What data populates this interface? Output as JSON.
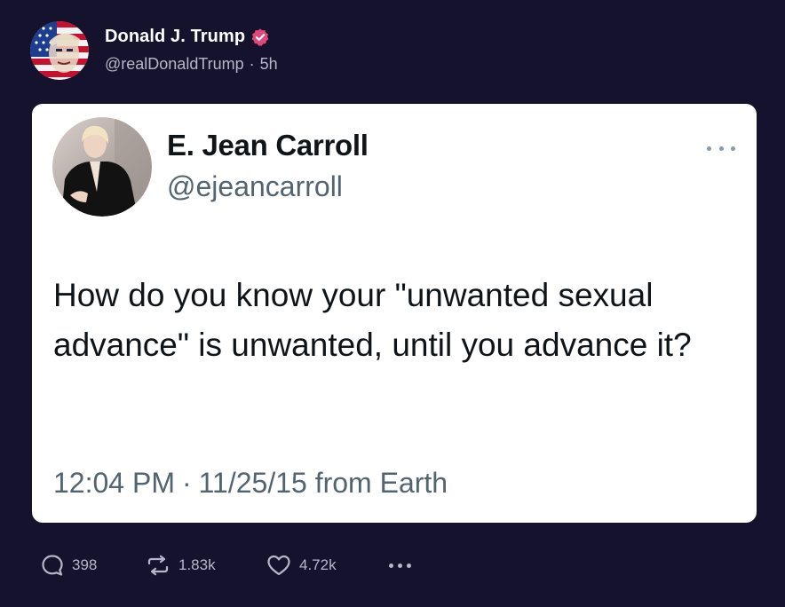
{
  "post": {
    "author_name": "Donald J. Trump",
    "author_handle": "@realDonaldTrump",
    "separator": "·",
    "timestamp": "5h"
  },
  "quoted_tweet": {
    "author_name": "E. Jean Carroll",
    "author_handle": "@ejeancarroll",
    "text": "How do you know your \"unwanted sexual advance\" is unwanted, until you advance it?",
    "time": "12:04 PM",
    "separator": "·",
    "date_source": "11/25/15 from Earth"
  },
  "actions": {
    "replies": "398",
    "reposts": "1.83k",
    "likes": "4.72k"
  },
  "icons": {
    "verified": "verified-badge-icon",
    "reply": "comment-bubble-icon",
    "repost": "repost-arrows-icon",
    "like": "heart-icon",
    "more": "more-dots-icon"
  },
  "colors": {
    "background": "#15122d",
    "verified_badge": "#e0487a",
    "card_background": "#ffffff",
    "muted_text": "#536471"
  }
}
